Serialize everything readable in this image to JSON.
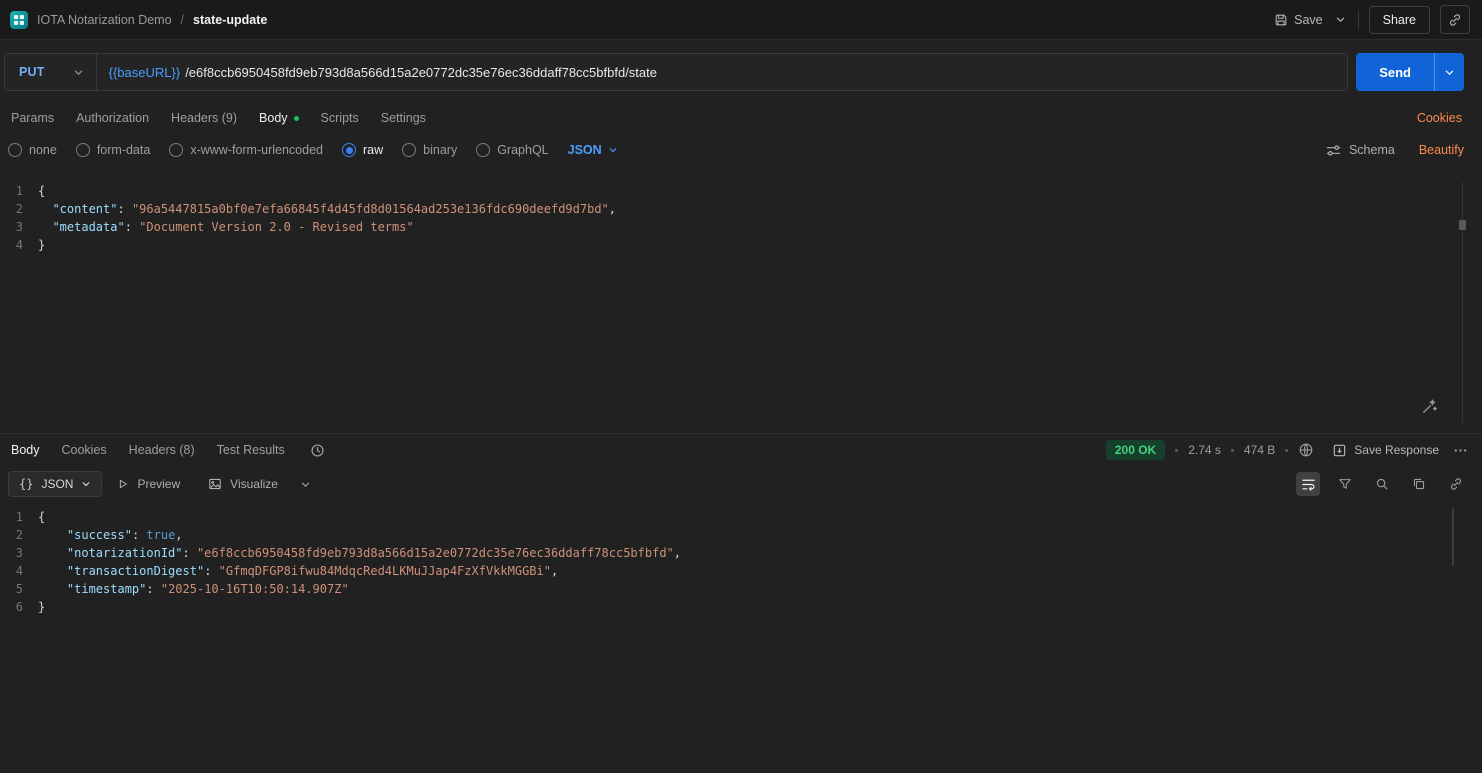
{
  "topbar": {
    "collection_name": "IOTA Notarization Demo",
    "separator": "/",
    "request_name": "state-update",
    "save_label": "Save",
    "share_label": "Share"
  },
  "request": {
    "method": "PUT",
    "url_variable": "{{baseURL}}",
    "url_path": "/e6f8ccb6950458fd9eb793d8a566d15a2e0772dc35e76ec36ddaff78cc5bfbfd/state",
    "send_label": "Send",
    "tabs": [
      {
        "label": "Params"
      },
      {
        "label": "Authorization"
      },
      {
        "label": "Headers (9)"
      },
      {
        "label": "Body"
      },
      {
        "label": "Scripts"
      },
      {
        "label": "Settings"
      }
    ],
    "active_tab": "Body",
    "cookies_link": "Cookies",
    "body_modes": [
      "none",
      "form-data",
      "x-www-form-urlencoded",
      "raw",
      "binary",
      "GraphQL"
    ],
    "selected_mode": "raw",
    "language": "JSON",
    "schema_label": "Schema",
    "beautify_label": "Beautify",
    "editor_lines": [
      {
        "num": "1",
        "tokens": [
          {
            "t": "punc",
            "v": "{"
          }
        ]
      },
      {
        "num": "2",
        "tokens": [
          {
            "t": "punc",
            "v": "  "
          },
          {
            "t": "key",
            "v": "\"content\""
          },
          {
            "t": "punc",
            "v": ": "
          },
          {
            "t": "str",
            "v": "\"96a5447815a0bf0e7efa66845f4d45fd8d01564ad253e136fdc690deefd9d7bd\""
          },
          {
            "t": "punc",
            "v": ","
          }
        ]
      },
      {
        "num": "3",
        "tokens": [
          {
            "t": "punc",
            "v": "  "
          },
          {
            "t": "key",
            "v": "\"metadata\""
          },
          {
            "t": "punc",
            "v": ": "
          },
          {
            "t": "str",
            "v": "\"Document Version 2.0 - Revised terms\""
          }
        ]
      },
      {
        "num": "4",
        "tokens": [
          {
            "t": "punc",
            "v": "}"
          }
        ]
      }
    ]
  },
  "response": {
    "tabs": [
      "Body",
      "Cookies",
      "Headers (8)",
      "Test Results"
    ],
    "active_tab": "Body",
    "status_code": "200 OK",
    "time": "2.74 s",
    "size": "474 B",
    "save_response_label": "Save Response",
    "format_label": "JSON",
    "braces_glyph": "{}",
    "preview_label": "Preview",
    "visualize_label": "Visualize",
    "editor_lines": [
      {
        "num": "1",
        "tokens": [
          {
            "t": "punc",
            "v": "{"
          }
        ]
      },
      {
        "num": "2",
        "tokens": [
          {
            "t": "punc",
            "v": "    "
          },
          {
            "t": "key",
            "v": "\"success\""
          },
          {
            "t": "punc",
            "v": ": "
          },
          {
            "t": "bool",
            "v": "true"
          },
          {
            "t": "punc",
            "v": ","
          }
        ]
      },
      {
        "num": "3",
        "tokens": [
          {
            "t": "punc",
            "v": "    "
          },
          {
            "t": "key",
            "v": "\"notarizationId\""
          },
          {
            "t": "punc",
            "v": ": "
          },
          {
            "t": "str",
            "v": "\"e6f8ccb6950458fd9eb793d8a566d15a2e0772dc35e76ec36ddaff78cc5bfbfd\""
          },
          {
            "t": "punc",
            "v": ","
          }
        ]
      },
      {
        "num": "4",
        "tokens": [
          {
            "t": "punc",
            "v": "    "
          },
          {
            "t": "key",
            "v": "\"transactionDigest\""
          },
          {
            "t": "punc",
            "v": ": "
          },
          {
            "t": "str",
            "v": "\"GfmqDFGP8ifwu84MdqcRed4LKMuJJap4FzXfVkkMGGBi\""
          },
          {
            "t": "punc",
            "v": ","
          }
        ]
      },
      {
        "num": "5",
        "tokens": [
          {
            "t": "punc",
            "v": "    "
          },
          {
            "t": "key",
            "v": "\"timestamp\""
          },
          {
            "t": "punc",
            "v": ": "
          },
          {
            "t": "str",
            "v": "\"2025-10-16T10:50:14.907Z\""
          }
        ]
      },
      {
        "num": "6",
        "tokens": [
          {
            "t": "punc",
            "v": "}"
          }
        ]
      }
    ]
  },
  "colors": {
    "accent_orange": "#ff8a4e",
    "send_blue": "#1064d8",
    "method_put_blue": "#74aef6",
    "status_green": "#43d17c",
    "selected_radio_blue": "#3f7ef7"
  }
}
